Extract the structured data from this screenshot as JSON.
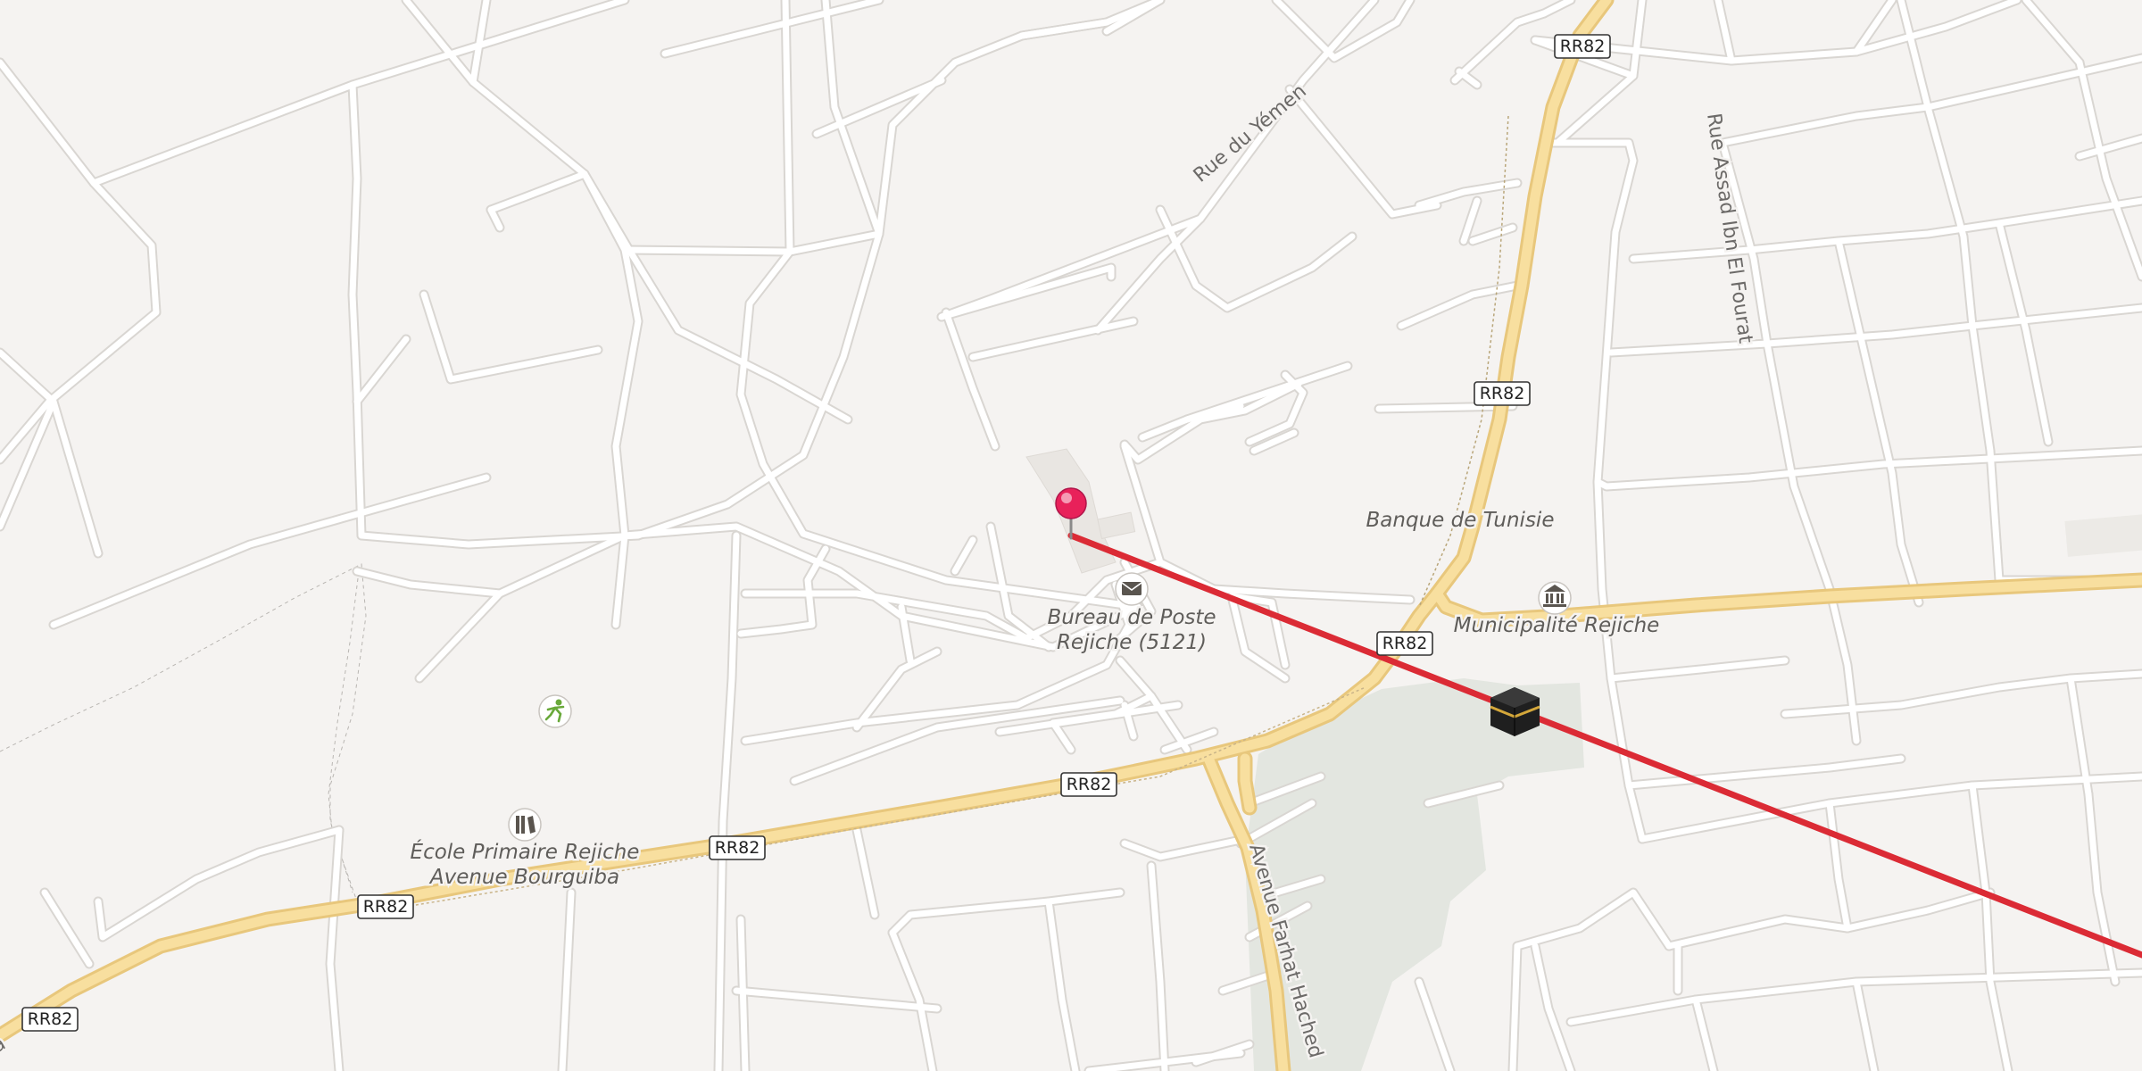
{
  "map": {
    "route_color": "#db2b35",
    "pin_color": "#e8215a",
    "major_road_color": "#f8df9f",
    "park_color": "#e3e6e0",
    "road_shields": [
      "RR82",
      "RR82",
      "RR82",
      "RR82",
      "RR82",
      "RR82",
      "RR82"
    ],
    "streets": {
      "rue_du_yemen": "Rue du Yémen",
      "rue_assad": "Rue Assad Ibn El Fourat",
      "avenue_farhat": "Avenue Farhat Hached",
      "edge_fragment": "a"
    },
    "pois": {
      "banque": "Banque de Tunisie",
      "poste_line1": "Bureau de Poste",
      "poste_line2": "Rejiche (5121)",
      "municipalite": "Municipalité Rejiche",
      "ecole_line1": "École Primaire Rejiche",
      "ecole_line2": "Avenue Bourguiba"
    },
    "icons": {
      "post_office": "envelope-icon",
      "municipality": "government-building-icon",
      "school": "school-icon",
      "sports": "sports-icon",
      "kaaba": "kaaba-icon",
      "location_pin": "map-pin-icon"
    }
  }
}
